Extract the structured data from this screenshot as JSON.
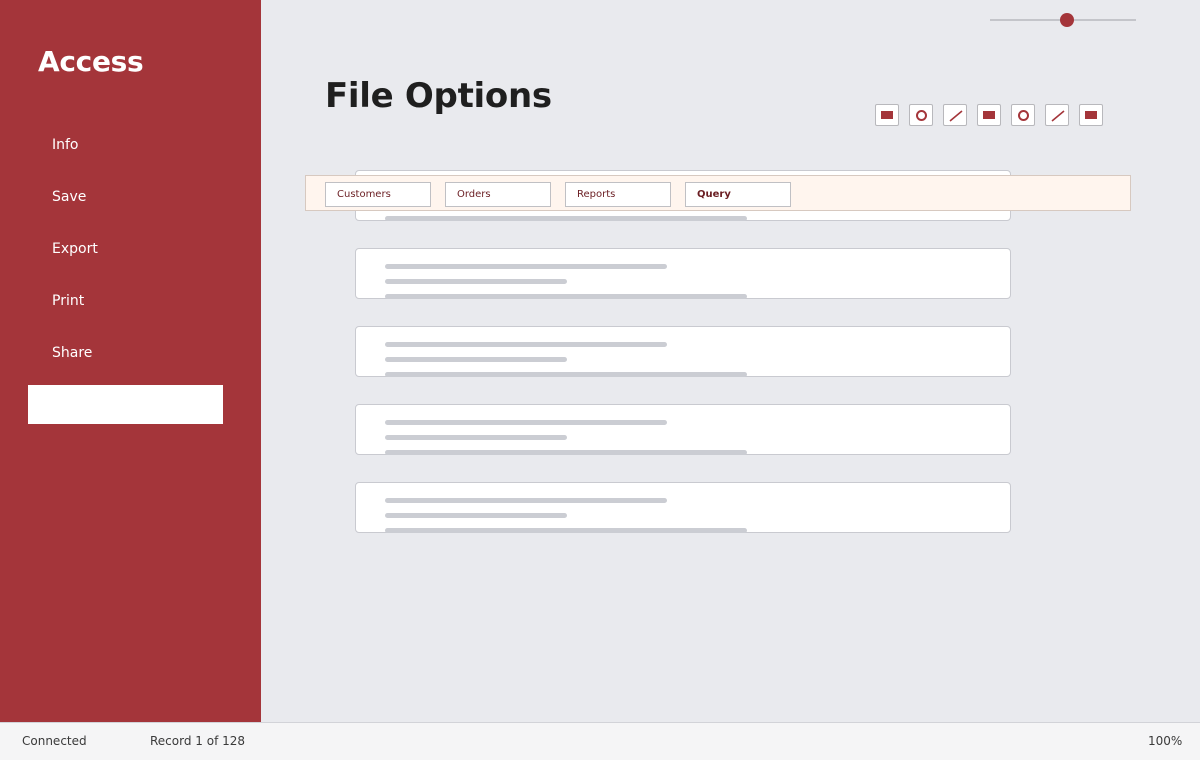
{
  "app": {
    "title": "Access"
  },
  "sidebar": {
    "items": [
      {
        "label": "Info"
      },
      {
        "label": "Save"
      },
      {
        "label": "Export"
      },
      {
        "label": "Print"
      },
      {
        "label": "Share"
      },
      {
        "label": ""
      }
    ],
    "selected_index": 5
  },
  "main": {
    "title": "File Options",
    "toolbar": [
      {
        "icon": "rectangle-icon"
      },
      {
        "icon": "circle-icon"
      },
      {
        "icon": "line-icon"
      },
      {
        "icon": "rectangle-icon"
      },
      {
        "icon": "circle-icon"
      },
      {
        "icon": "line-icon"
      },
      {
        "icon": "rectangle-icon"
      }
    ],
    "tabs": [
      {
        "label": "Customers"
      },
      {
        "label": "Orders"
      },
      {
        "label": "Reports"
      },
      {
        "label": "Query"
      }
    ],
    "active_tab": "Query"
  },
  "statusbar": {
    "connection": "Connected",
    "record": "Record 1 of 128",
    "zoom": "100%",
    "zoom_slider_fraction": 0.5
  },
  "colors": {
    "accent": "#a4353a",
    "background": "#e9eaee",
    "tabstrip": "#fff5ee"
  }
}
